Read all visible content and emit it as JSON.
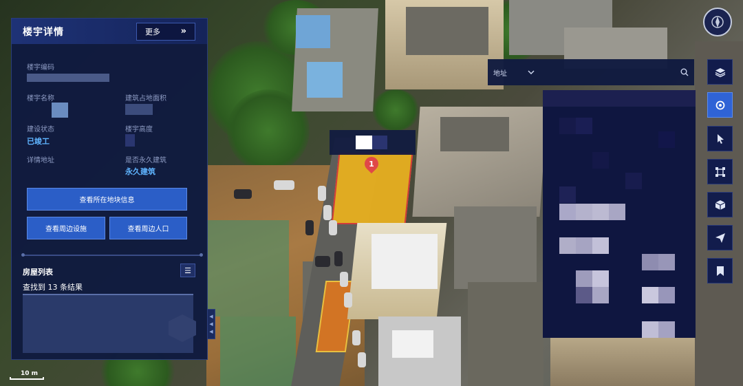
{
  "panel": {
    "title": "楼宇详情",
    "more_label": "更多",
    "fields": {
      "building_code_label": "楼宇编码",
      "building_name_label": "楼宇名称",
      "floor_area_label": "建筑占地面积",
      "construction_status_label": "建设状态",
      "construction_status_value": "已竣工",
      "building_height_label": "楼宇高度",
      "address_label": "详情地址",
      "permanent_label": "是否永久建筑",
      "permanent_value": "永久建筑"
    },
    "buttons": {
      "parcel_info": "查看所在地块信息",
      "nearby_facilities": "查看周边设施",
      "nearby_population": "查看周边人口"
    },
    "house_list": {
      "title": "房屋列表",
      "count_text": "查找到 13 条结果"
    }
  },
  "search": {
    "type_label": "地址",
    "placeholder": ""
  },
  "marker": {
    "number": "1"
  },
  "scale": {
    "label": "10 m"
  },
  "toolbar": {
    "items": [
      {
        "name": "layers-icon"
      },
      {
        "name": "search-icon",
        "active": true
      },
      {
        "name": "pointer-icon"
      },
      {
        "name": "select-area-icon"
      },
      {
        "name": "cube-icon"
      },
      {
        "name": "send-icon"
      },
      {
        "name": "bookmark-icon"
      }
    ]
  },
  "colors": {
    "panel_bg": "#101a40",
    "accent_blue": "#2b5ec7",
    "value_blue": "#5fb4ff",
    "highlight_building": "#e8b020"
  }
}
